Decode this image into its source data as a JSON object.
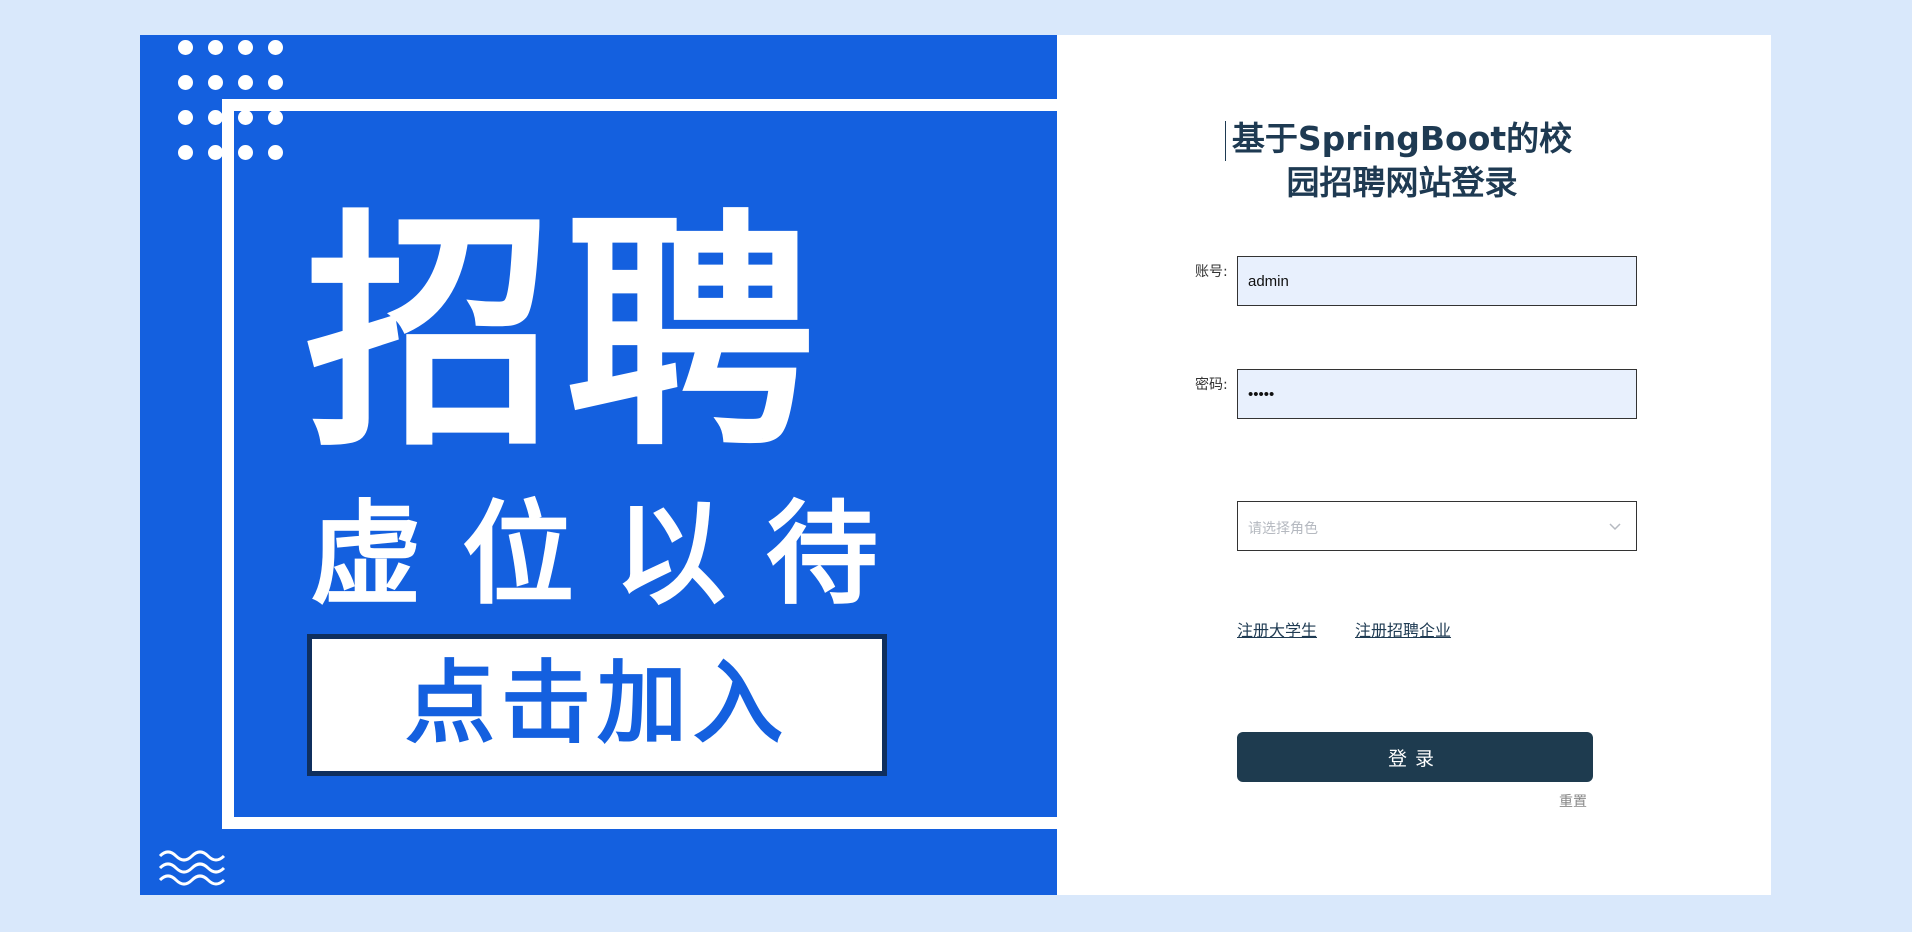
{
  "poster": {
    "headline": "招聘",
    "subline": "虚位以待",
    "join_label": "点击加入"
  },
  "login": {
    "title": "基于SpringBoot的校园招聘网站登录",
    "account_label": "账号:",
    "account_value": "admin",
    "password_label": "密码:",
    "password_value": "•••••",
    "role_placeholder": "请选择角色",
    "register_student": "注册大学生",
    "register_company": "注册招聘企业",
    "login_button": "登录",
    "reset": "重置"
  },
  "colors": {
    "page_bg": "#d9e8fb",
    "poster_blue": "#1460df",
    "button_dark": "#1e3b4f",
    "input_bg": "#e8f0fd"
  }
}
